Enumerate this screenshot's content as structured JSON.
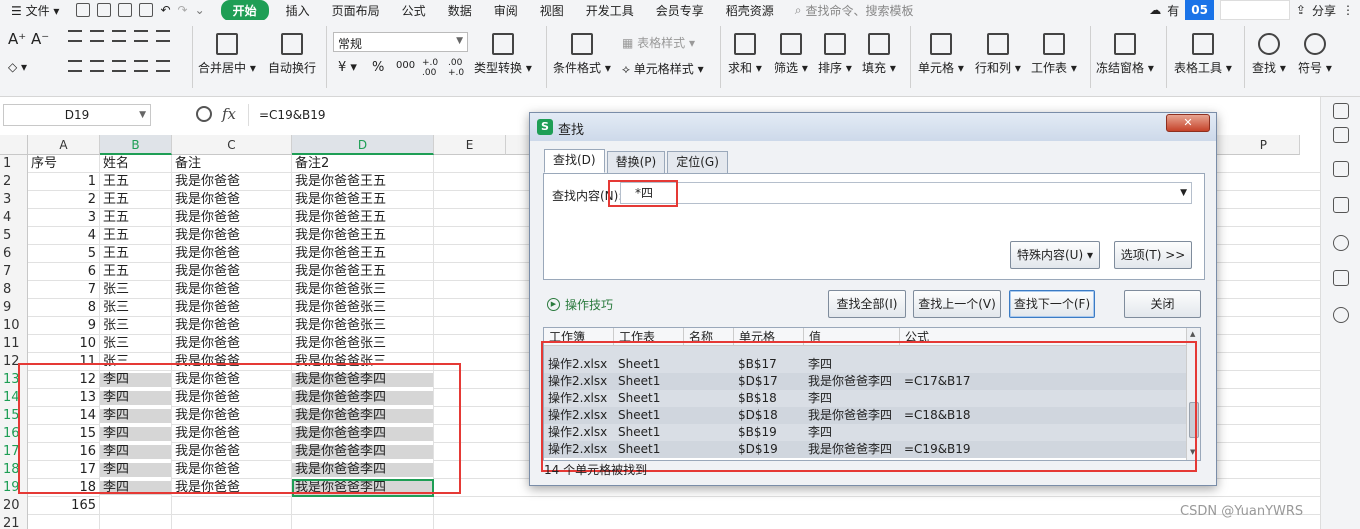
{
  "menubar": {
    "file": "文件",
    "items": [
      "开始",
      "插入",
      "页面布局",
      "公式",
      "数据",
      "审阅",
      "视图",
      "开发工具",
      "会员专享",
      "稻壳资源"
    ],
    "active_index": 0,
    "search_placeholder": "查找命令、搜索模板",
    "right_truncated": "有",
    "share": "分享",
    "accent": "#1e9e55"
  },
  "ribbon": {
    "number_format": "常规",
    "merge_center": "合并居中",
    "wrap": "自动换行",
    "currency": "¥",
    "percent": "%",
    "thousands": "000",
    "inc_decimal": "+.0 .00",
    "dec_decimal": ".00 +.0",
    "convert": "类型转换",
    "cond_format": "条件格式",
    "table_style": "表格样式",
    "cell_style": "单元格样式",
    "sum": "求和",
    "filter": "筛选",
    "sort": "排序",
    "fill": "填充",
    "cell": "单元格",
    "row_col": "行和列",
    "worksheet": "工作表",
    "freeze": "冻结窗格",
    "table_tools": "表格工具",
    "find": "查找",
    "symbol": "符号"
  },
  "formula_bar": {
    "name_box": "D19",
    "fx": "fx",
    "formula": "=C19&B19"
  },
  "sheet": {
    "columns": [
      "A",
      "B",
      "C",
      "D",
      "E",
      "P"
    ],
    "rows": [
      {
        "n": "1",
        "a": "序号",
        "b": "姓名",
        "c": "备注",
        "d": "备注2"
      },
      {
        "n": "2",
        "a": "1",
        "b": "王五",
        "c": "我是你爸爸",
        "d": "我是你爸爸王五"
      },
      {
        "n": "3",
        "a": "2",
        "b": "王五",
        "c": "我是你爸爸",
        "d": "我是你爸爸王五"
      },
      {
        "n": "4",
        "a": "3",
        "b": "王五",
        "c": "我是你爸爸",
        "d": "我是你爸爸王五"
      },
      {
        "n": "5",
        "a": "4",
        "b": "王五",
        "c": "我是你爸爸",
        "d": "我是你爸爸王五"
      },
      {
        "n": "6",
        "a": "5",
        "b": "王五",
        "c": "我是你爸爸",
        "d": "我是你爸爸王五"
      },
      {
        "n": "7",
        "a": "6",
        "b": "王五",
        "c": "我是你爸爸",
        "d": "我是你爸爸王五"
      },
      {
        "n": "8",
        "a": "7",
        "b": "张三",
        "c": "我是你爸爸",
        "d": "我是你爸爸张三"
      },
      {
        "n": "9",
        "a": "8",
        "b": "张三",
        "c": "我是你爸爸",
        "d": "我是你爸爸张三"
      },
      {
        "n": "10",
        "a": "9",
        "b": "张三",
        "c": "我是你爸爸",
        "d": "我是你爸爸张三"
      },
      {
        "n": "11",
        "a": "10",
        "b": "张三",
        "c": "我是你爸爸",
        "d": "我是你爸爸张三"
      },
      {
        "n": "12",
        "a": "11",
        "b": "张三",
        "c": "我是你爸爸",
        "d": "我是你爸爸张三"
      },
      {
        "n": "13",
        "a": "12",
        "b": "李四",
        "c": "我是你爸爸",
        "d": "我是你爸爸李四"
      },
      {
        "n": "14",
        "a": "13",
        "b": "李四",
        "c": "我是你爸爸",
        "d": "我是你爸爸李四"
      },
      {
        "n": "15",
        "a": "14",
        "b": "李四",
        "c": "我是你爸爸",
        "d": "我是你爸爸李四"
      },
      {
        "n": "16",
        "a": "15",
        "b": "李四",
        "c": "我是你爸爸",
        "d": "我是你爸爸李四"
      },
      {
        "n": "17",
        "a": "16",
        "b": "李四",
        "c": "我是你爸爸",
        "d": "我是你爸爸李四"
      },
      {
        "n": "18",
        "a": "17",
        "b": "李四",
        "c": "我是你爸爸",
        "d": "我是你爸爸李四"
      },
      {
        "n": "19",
        "a": "18",
        "b": "李四",
        "c": "我是你爸爸",
        "d": "我是你爸爸李四"
      },
      {
        "n": "20",
        "a": "165",
        "b": "",
        "c": "",
        "d": ""
      },
      {
        "n": "21",
        "a": "",
        "b": "",
        "c": "",
        "d": ""
      }
    ]
  },
  "dialog": {
    "title": "查找",
    "tabs": [
      "查找(D)",
      "替换(P)",
      "定位(G)"
    ],
    "find_label": "查找内容(N):",
    "find_value": "*四",
    "special": "特殊内容(U)",
    "options": "选项(T) >>",
    "tips": "操作技巧",
    "btn_find_all": "查找全部(I)",
    "btn_find_prev": "查找上一个(V)",
    "btn_find_next": "查找下一个(F)",
    "btn_close": "关闭",
    "columns": [
      "工作簿",
      "工作表",
      "名称",
      "单元格",
      "值",
      "公式"
    ],
    "results": [
      {
        "wb": "操作2.xlsx",
        "ws": "Sheet1",
        "name": "",
        "cell": "$B$17",
        "value": "李四",
        "formula": ""
      },
      {
        "wb": "操作2.xlsx",
        "ws": "Sheet1",
        "name": "",
        "cell": "$D$17",
        "value": "我是你爸爸李四",
        "formula": "=C17&B17"
      },
      {
        "wb": "操作2.xlsx",
        "ws": "Sheet1",
        "name": "",
        "cell": "$B$18",
        "value": "李四",
        "formula": ""
      },
      {
        "wb": "操作2.xlsx",
        "ws": "Sheet1",
        "name": "",
        "cell": "$D$18",
        "value": "我是你爸爸李四",
        "formula": "=C18&B18"
      },
      {
        "wb": "操作2.xlsx",
        "ws": "Sheet1",
        "name": "",
        "cell": "$B$19",
        "value": "李四",
        "formula": ""
      },
      {
        "wb": "操作2.xlsx",
        "ws": "Sheet1",
        "name": "",
        "cell": "$D$19",
        "value": "我是你爸爸李四",
        "formula": "=C19&B19"
      }
    ],
    "status": "14 个单元格被找到"
  },
  "watermark": "CSDN @YuanYWRS"
}
